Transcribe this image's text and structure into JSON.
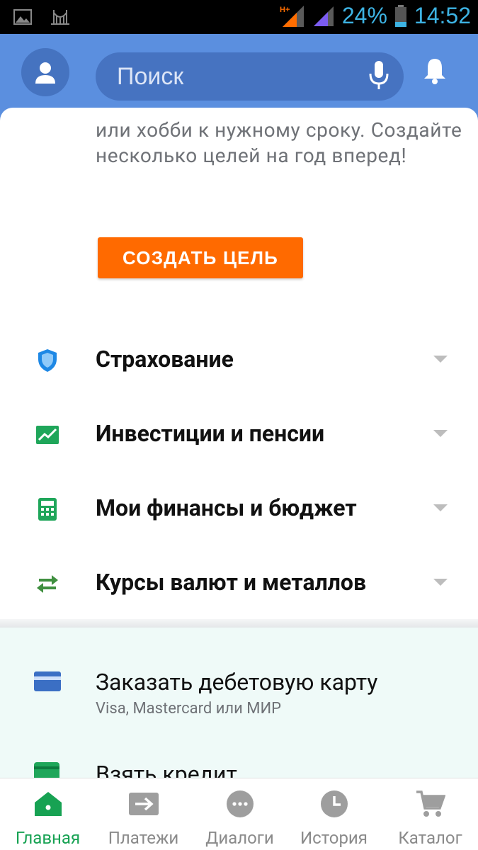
{
  "statusbar": {
    "network": "H+",
    "battery": "24%",
    "time": "14:52"
  },
  "header": {
    "search_placeholder": "Поиск"
  },
  "goal": {
    "description": "или хобби к нужному сроку. Создайте несколько целей на год вперед!",
    "button_label": "СОЗДАТЬ ЦЕЛЬ"
  },
  "menu": [
    {
      "label": "Страхование",
      "icon": "shield-icon",
      "color": "#1e88e5"
    },
    {
      "label": "Инвестиции и пенсии",
      "icon": "chart-icon",
      "color": "#1fa65a"
    },
    {
      "label": "Мои финансы и бюджет",
      "icon": "calculator-icon",
      "color": "#1fa65a"
    },
    {
      "label": "Курсы валют и металлов",
      "icon": "exchange-icon",
      "color": "#3f8f3f"
    }
  ],
  "promo": [
    {
      "title": "Заказать дебетовую карту",
      "subtitle": "Visa, Mastercard или МИР",
      "icon": "card-icon",
      "color": "#3b6fc4"
    },
    {
      "title": "Взять кредит",
      "icon": "wallet-icon",
      "color": "#1fa65a"
    }
  ],
  "bottom_nav": [
    {
      "label": "Главная",
      "icon": "home-icon",
      "active": true
    },
    {
      "label": "Платежи",
      "icon": "arrow-icon"
    },
    {
      "label": "Диалоги",
      "icon": "chat-icon"
    },
    {
      "label": "История",
      "icon": "clock-icon"
    },
    {
      "label": "Каталог",
      "icon": "cart-icon"
    }
  ],
  "colors": {
    "header": "#5b8fdf",
    "accent": "#ff6a00",
    "active_nav": "#17a253"
  }
}
